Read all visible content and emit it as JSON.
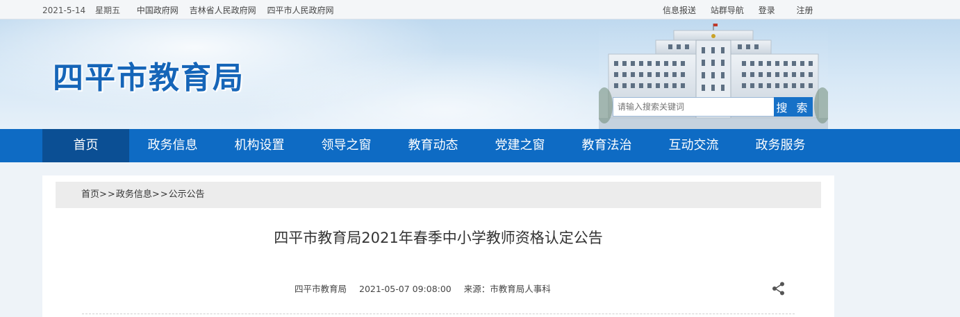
{
  "topbar": {
    "date": "2021-5-14",
    "weekday": "星期五",
    "links": [
      "中国政府网",
      "吉林省人民政府网",
      "四平市人民政府网"
    ],
    "right_links": [
      "信息报送",
      "站群导航",
      "登录",
      "注册"
    ]
  },
  "header": {
    "site_title": "四平市教育局"
  },
  "search": {
    "placeholder": "请输入搜索关键词",
    "button_label": "搜 索"
  },
  "nav": {
    "items": [
      "首页",
      "政务信息",
      "机构设置",
      "领导之窗",
      "教育动态",
      "党建之窗",
      "教育法治",
      "互动交流",
      "政务服务"
    ],
    "active_index": 0
  },
  "breadcrumb": {
    "items": [
      "首页",
      "政务信息",
      "公示公告"
    ],
    "separator": ">>"
  },
  "article": {
    "title": "四平市教育局2021年春季中小学教师资格认定公告",
    "publisher": "四平市教育局",
    "datetime": "2021-05-07 09:08:00",
    "source": "来源：市教育局人事科"
  },
  "icons": {
    "share": "share-icon"
  },
  "colors": {
    "nav_bg": "#0e6bc4",
    "nav_active_bg": "#0b4f94",
    "title_blue": "#1565b8",
    "search_button": "#1771c7"
  }
}
